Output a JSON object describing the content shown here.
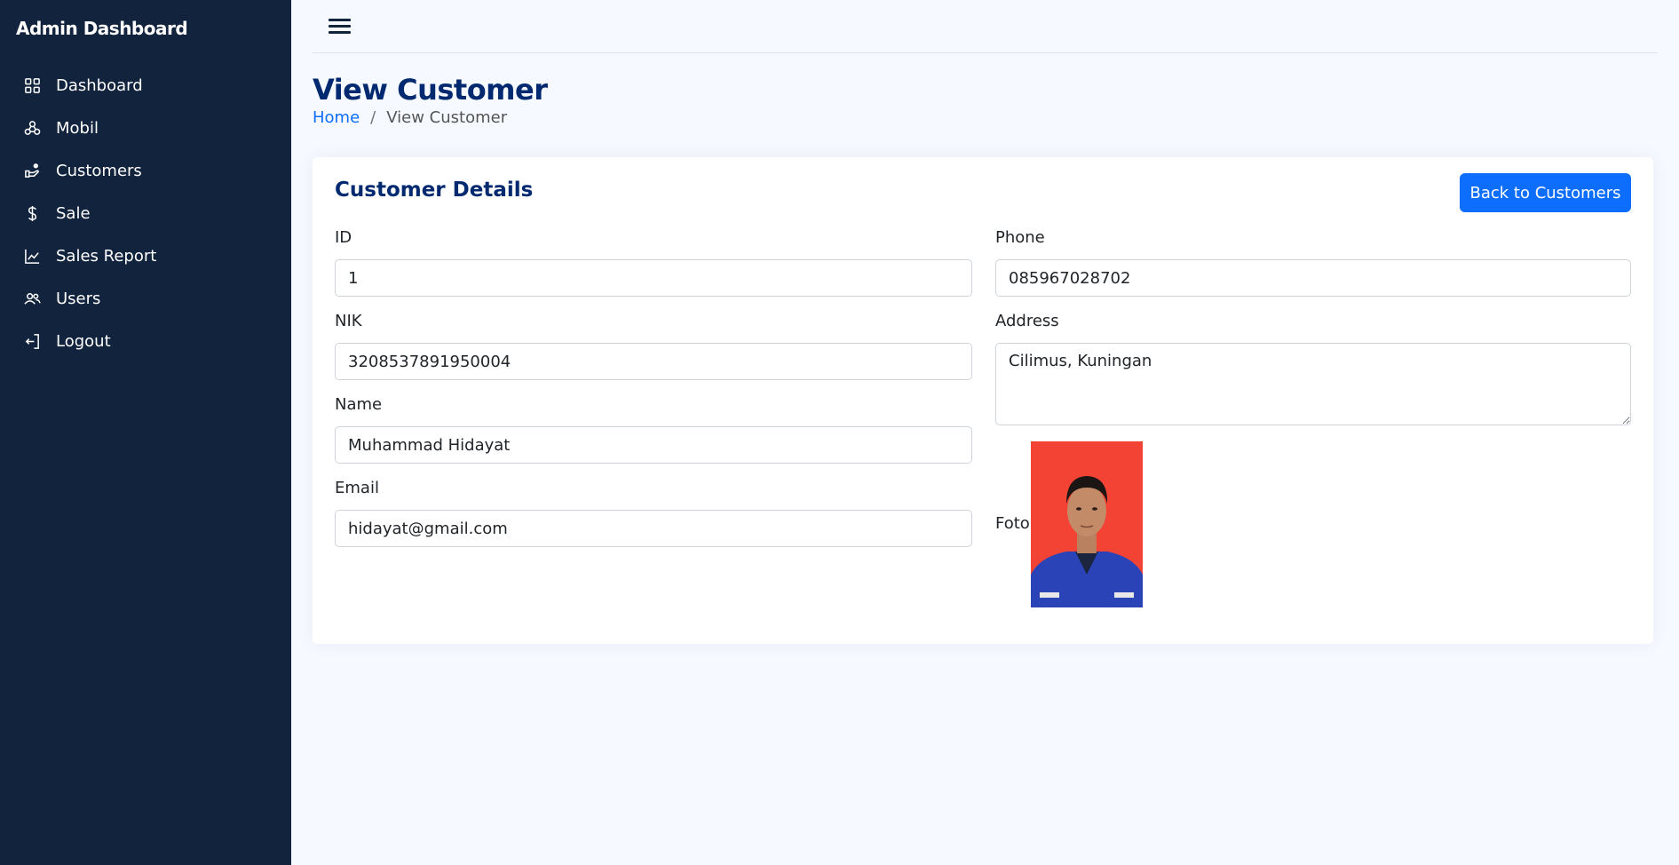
{
  "sidebar": {
    "brand": "Admin Dashboard",
    "items": [
      {
        "label": "Dashboard",
        "icon": "grid-icon"
      },
      {
        "label": "Mobil",
        "icon": "share-nodes-icon"
      },
      {
        "label": "Customers",
        "icon": "customers-icon"
      },
      {
        "label": "Sale",
        "icon": "dollar-icon"
      },
      {
        "label": "Sales Report",
        "icon": "chart-line-icon"
      },
      {
        "label": "Users",
        "icon": "users-icon"
      },
      {
        "label": "Logout",
        "icon": "logout-icon"
      }
    ]
  },
  "header": {
    "menu_icon": "hamburger-icon"
  },
  "page": {
    "title": "View Customer",
    "breadcrumb": {
      "home": "Home",
      "separator": "/",
      "current": "View Customer"
    }
  },
  "card": {
    "title": "Customer Details",
    "back_button": "Back to Customers",
    "fields": {
      "id": {
        "label": "ID",
        "value": "1"
      },
      "nik": {
        "label": "NIK",
        "value": "3208537891950004"
      },
      "name": {
        "label": "Name",
        "value": "Muhammad Hidayat"
      },
      "email": {
        "label": "Email",
        "value": "hidayat@gmail.com"
      },
      "phone": {
        "label": "Phone",
        "value": "085967028702"
      },
      "address": {
        "label": "Address",
        "value": "Cilimus, Kuningan"
      },
      "foto": {
        "label": "Foto"
      }
    }
  },
  "colors": {
    "sidebar_bg": "#12233d",
    "page_bg": "#f6f9ff",
    "title": "#012970",
    "primary": "#0d6efd",
    "photo_bg": "#f24334"
  }
}
